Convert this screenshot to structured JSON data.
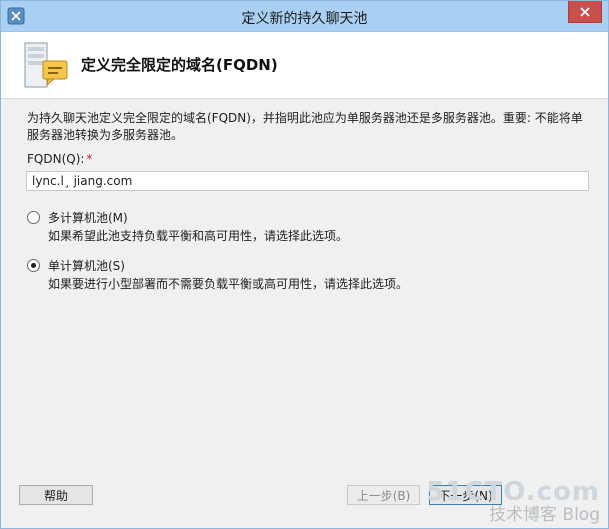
{
  "window": {
    "title": "定义新的持久聊天池"
  },
  "header": {
    "title": "定义完全限定的域名(FQDN)"
  },
  "description": "为持久聊天池定义完全限定的域名(FQDN)，并指明此池应为单服务器池还是多服务器池。重要: 不能将单服务器池转换为多服务器池。",
  "fqdn": {
    "label": "FQDN(Q):",
    "required_marker": "*",
    "value": "lync.l¸ jiang.com"
  },
  "options": [
    {
      "label": "多计算机池(M)",
      "description": "如果希望此池支持负载平衡和高可用性，请选择此选项。",
      "selected": false
    },
    {
      "label": "单计算机池(S)",
      "description": "如果要进行小型部署而不需要负载平衡或高可用性，请选择此选项。",
      "selected": true
    }
  ],
  "footer": {
    "help_label": "帮助",
    "back_label": "上一步(B)",
    "next_label": "下一步(N)"
  },
  "watermark": {
    "line1": "51CTO.com",
    "line2": "技术博客 Blog"
  },
  "colors": {
    "titlebar": "#a9d0f2",
    "close": "#c7504c"
  }
}
